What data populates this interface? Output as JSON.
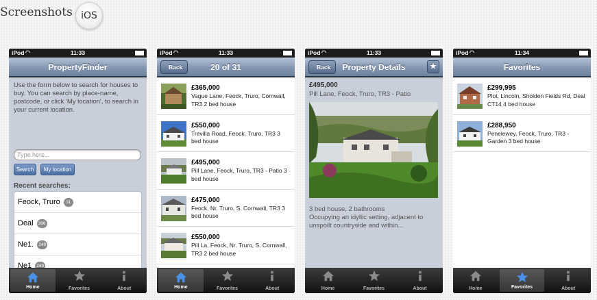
{
  "heading": "Screenshots",
  "platform_badge": "iOS",
  "status": {
    "carrier": "iPod",
    "times": [
      "11:33",
      "11:33",
      "11:33",
      "11:34"
    ]
  },
  "tabs": [
    {
      "label": "Home",
      "icon": "house-icon"
    },
    {
      "label": "Favorites",
      "icon": "star-icon"
    },
    {
      "label": "About",
      "icon": "info-icon"
    }
  ],
  "search_screen": {
    "title": "PropertyFinder",
    "intro": "Use the form below to search for houses to buy. You can search by place-name, postcode, or click 'My location', to search in your current location.",
    "input_placeholder": "Type here...",
    "go_label": "Search",
    "location_label": "My location",
    "recent_label": "Recent searches:",
    "recent": [
      {
        "term": "Feock, Truro",
        "count": "31"
      },
      {
        "term": "Deal",
        "count": "396"
      },
      {
        "term": "Ne1.",
        "count": "249"
      },
      {
        "term": "Ne1",
        "count": "249"
      }
    ]
  },
  "results_screen": {
    "back_label": "Back",
    "title": "20 of 31",
    "items": [
      {
        "price": "£365,000",
        "desc": "Vague Lane, Feock, Truro, Cornwall, TR3 2 bed house"
      },
      {
        "price": "£550,000",
        "desc": "Trevilla Road, Feock, Truro, TR3 3 bed house"
      },
      {
        "price": "£495,000",
        "desc": "Pill Lane, Feock, Truro, TR3 - Patio 3 bed house"
      },
      {
        "price": "£475,000",
        "desc": "Feock, Nr. Truro, S. Cornwall, TR3 3 bed house"
      },
      {
        "price": "£550,000",
        "desc": "Pill La, Feock, Nr. Truro, S. Cornwall, TR3 2 bed house"
      }
    ]
  },
  "details_screen": {
    "back_label": "Back",
    "title": "Property Details",
    "price": "£495,000",
    "address": "Pill Lane, Feock, Truro, TR3 - Patio",
    "summary": "3 bed house, 2 bathrooms",
    "description": "Occupying an idyllic setting, adjacent to unspoilt countryside and within..."
  },
  "favorites_screen": {
    "title": "Favorites",
    "items": [
      {
        "price": "£299,995",
        "desc": "Plot, Lincoln, Sholden Fields Rd, Deal CT14 4 bed house"
      },
      {
        "price": "£288,950",
        "desc": "Penelewey, Feock, Truro, TR3 - Garden 3 bed house"
      }
    ]
  },
  "colors": {
    "nav": "#8597b0",
    "accent": "#4a6fa3",
    "tab_active": "#3b7fe0"
  }
}
